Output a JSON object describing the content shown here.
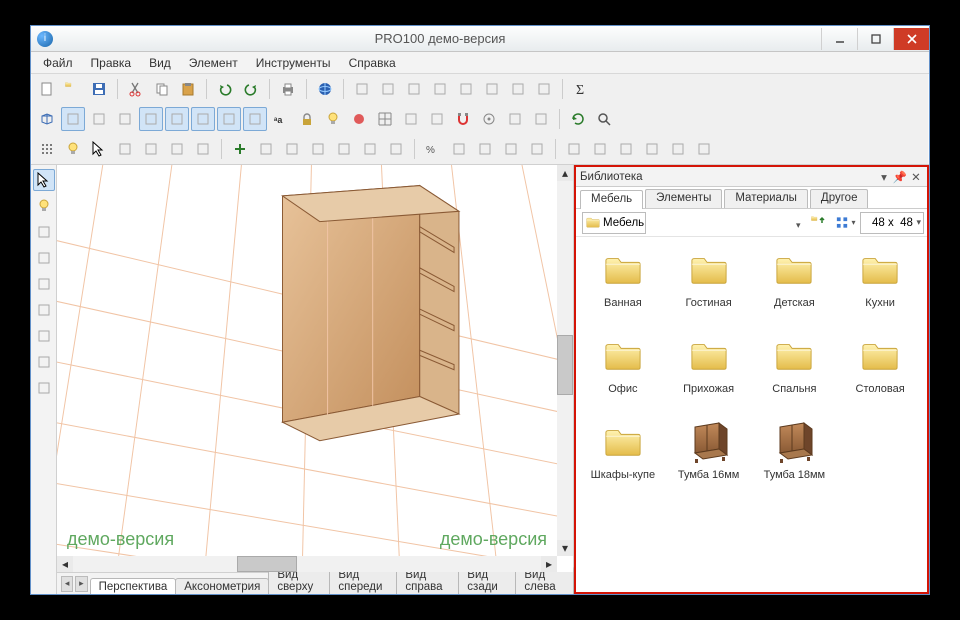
{
  "window": {
    "title": "PRO100 демо-версия"
  },
  "menu": [
    "Файл",
    "Правка",
    "Вид",
    "Элемент",
    "Инструменты",
    "Справка"
  ],
  "toolbar_row1": [
    "new",
    "open",
    "save",
    "sep",
    "cut",
    "copy",
    "paste",
    "sep",
    "undo",
    "redo",
    "sep",
    "print",
    "sep",
    "globe",
    "sep",
    "layer1",
    "layer2",
    "layer3",
    "report1",
    "report2",
    "bed",
    "play",
    "dd",
    "sep",
    "sigma"
  ],
  "toolbar_row2": [
    "cube-wire",
    "persp",
    "ortho",
    "r1",
    "r2",
    "r3",
    "r4",
    "r5",
    "r6",
    "label",
    "lock",
    "bulb",
    "color",
    "grid3",
    "gridfine",
    "snap",
    "magnet",
    "target",
    "target2",
    "target3",
    "sep",
    "refresh",
    "zoom"
  ],
  "toolbar_row3": [
    "dots",
    "light",
    "arrow",
    "m1",
    "m2",
    "m3",
    "m4",
    "sep",
    "plus",
    "aleft",
    "acenter",
    "aright",
    "atop",
    "amid",
    "abot",
    "sep",
    "pct",
    "rot",
    "rot2",
    "rot3",
    "rot4",
    "sep",
    "g1",
    "g2",
    "g3",
    "g4",
    "g5",
    "g6"
  ],
  "lefttools": [
    "pointer",
    "light",
    "d1",
    "d2",
    "d3",
    "d4",
    "d5",
    "d6",
    "d7"
  ],
  "view_tabs": [
    "Перспектива",
    "Аксонометрия",
    "Вид сверху",
    "Вид спереди",
    "Вид справа",
    "Вид сзади",
    "Вид слева"
  ],
  "view_tabs_active": 0,
  "watermark": "демо-версия",
  "library": {
    "title": "Библиотека",
    "tabs": [
      "Мебель",
      "Элементы",
      "Материалы",
      "Другое"
    ],
    "active_tab": 0,
    "path": "Мебель",
    "thumb_size": "48 x  48",
    "items": [
      {
        "type": "folder",
        "label": "Ванная"
      },
      {
        "type": "folder",
        "label": "Гостиная"
      },
      {
        "type": "folder",
        "label": "Детская"
      },
      {
        "type": "folder",
        "label": "Кухни"
      },
      {
        "type": "folder",
        "label": "Офис"
      },
      {
        "type": "folder",
        "label": "Прихожая"
      },
      {
        "type": "folder",
        "label": "Спальня"
      },
      {
        "type": "folder",
        "label": "Столовая"
      },
      {
        "type": "folder",
        "label": "Шкафы-купе"
      },
      {
        "type": "model",
        "label": "Тумба 16мм"
      },
      {
        "type": "model",
        "label": "Тумба 18мм"
      }
    ]
  }
}
